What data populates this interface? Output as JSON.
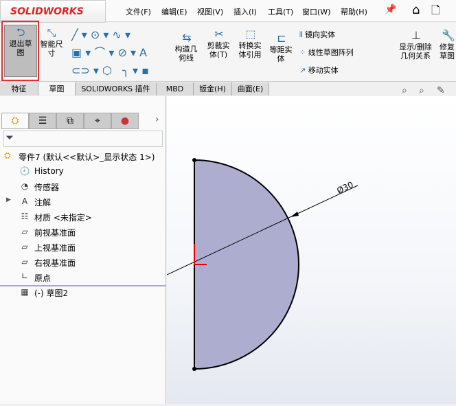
{
  "app": {
    "logo": "SOLIDWORKS"
  },
  "menu": [
    "文件(F)",
    "编辑(E)",
    "视图(V)",
    "插入(I)",
    "工具(T)",
    "窗口(W)",
    "帮助(H)"
  ],
  "ribbon": {
    "exit_sketch": "退出草图",
    "smart_dim": "智能尺寸",
    "construction": "构造几何线",
    "trim": "剪裁实体(T)",
    "convert": "转换实体引用",
    "offset": "等距实体",
    "mirror": "镜向实体",
    "linear_pattern": "线性草图阵列",
    "move": "移动实体",
    "show_relations": "显示/删除几何关系",
    "repair": "修复草图"
  },
  "tabs": [
    "特征",
    "草图",
    "SOLIDWORKS 插件",
    "MBD",
    "钣金(H)",
    "曲面(E)"
  ],
  "tree": {
    "root": "零件7  (默认<<默认>_显示状态 1>)",
    "items": [
      "History",
      "传感器",
      "注解",
      "材质 <未指定>",
      "前视基准面",
      "上视基准面",
      "右视基准面",
      "原点",
      "(-) 草图2"
    ]
  },
  "sketch": {
    "dimension": "Ø30",
    "fill": "#adadd0"
  }
}
